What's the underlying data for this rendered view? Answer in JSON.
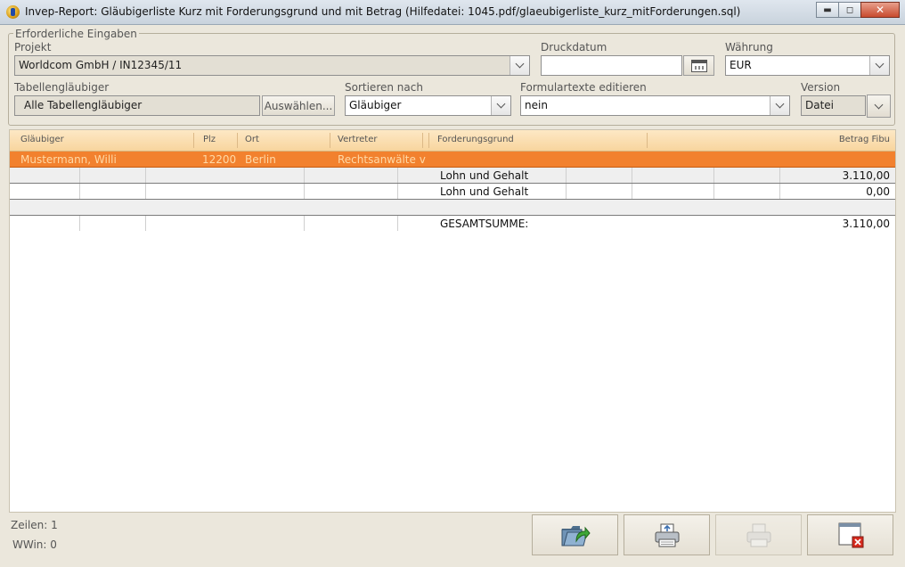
{
  "window": {
    "title": "Invep-Report: Gläubigerliste Kurz mit Forderungsgrund und mit Betrag   (Hilfedatei: 1045.pdf/glaeubigerliste_kurz_mitForderungen.sql)"
  },
  "form": {
    "legend": "Erforderliche Eingaben",
    "projekt": {
      "label": "Projekt",
      "value": "Worldcom GmbH / IN12345/11"
    },
    "druckdatum": {
      "label": "Druckdatum",
      "value": ""
    },
    "waehrung": {
      "label": "Währung",
      "value": "EUR"
    },
    "tabellenglaeubiger": {
      "label": "Tabellengläubiger",
      "value": "Alle Tabellengläubiger",
      "button": "Auswählen..."
    },
    "sortieren": {
      "label": "Sortieren nach",
      "value": "Gläubiger"
    },
    "formulartexte": {
      "label": "Formulartexte editieren",
      "value": "nein"
    },
    "version": {
      "label": "Version",
      "value": "Datei"
    }
  },
  "table": {
    "columns": [
      "Gläubiger",
      "Plz",
      "Ort",
      "Vertreter",
      "Forderungsgrund",
      "Betrag Fibu"
    ],
    "selected_row": {
      "glaeubiger": "Mustermann, Willi",
      "plz": "12200",
      "ort": "Berlin",
      "vertreter": "Rechtsanwälte v"
    },
    "detail_rows": [
      {
        "grund": "Lohn und Gehalt",
        "betrag": "3.110,00"
      },
      {
        "grund": "Lohn und Gehalt",
        "betrag": "0,00"
      },
      {
        "grund": "",
        "betrag": ""
      }
    ],
    "total": {
      "label": "GESAMTSUMME:",
      "value": "3.110,00"
    }
  },
  "status": {
    "zeilen": "Zeilen: 1",
    "wwin": "WWin: 0"
  },
  "icons": [
    "export-folder-icon",
    "print-icon",
    "print-disabled-icon",
    "close-window-icon"
  ]
}
